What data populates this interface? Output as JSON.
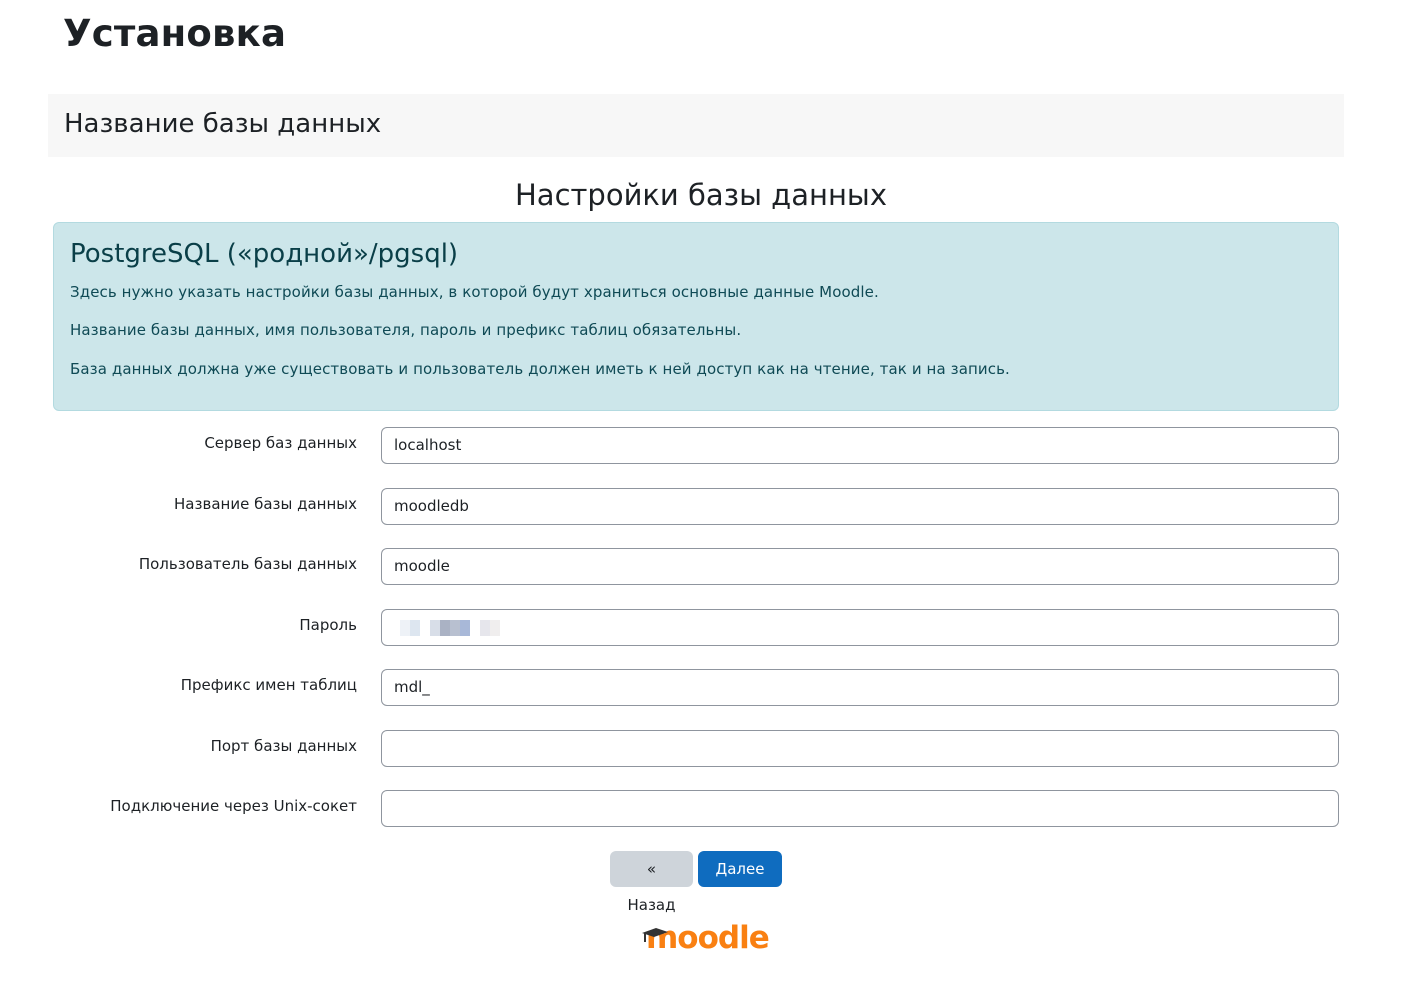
{
  "page": {
    "title": "Установка"
  },
  "stage": {
    "title": "Название базы данных"
  },
  "section": {
    "title": "Настройки базы данных"
  },
  "alert": {
    "heading": "PostgreSQL («родной»/pgsql)",
    "paragraphs": [
      "Здесь нужно указать настройки базы данных, в которой будут храниться основные данные Moodle.",
      "Название базы данных, имя пользователя, пароль и префикс таблиц обязательны.",
      "База данных должна уже существовать и пользователь должен иметь к ней доступ как на чтение, так и на запись."
    ]
  },
  "form": {
    "fields": [
      {
        "label": "Сервер баз данных",
        "value": "localhost"
      },
      {
        "label": "Название базы данных",
        "value": "moodledb"
      },
      {
        "label": "Пользователь базы данных",
        "value": "moodle"
      },
      {
        "label": "Пароль",
        "value": ""
      },
      {
        "label": "Префикс имен таблиц",
        "value": "mdl_"
      },
      {
        "label": "Порт базы данных",
        "value": ""
      },
      {
        "label": "Подключение через Unix-сокет",
        "value": ""
      }
    ]
  },
  "buttons": {
    "back": "« Назад",
    "next": "Далее »"
  },
  "logo": {
    "text": "moodle",
    "color": "#f98012"
  },
  "colors": {
    "primary": "#0f6cbf",
    "alert_bg": "#cce6ea"
  }
}
